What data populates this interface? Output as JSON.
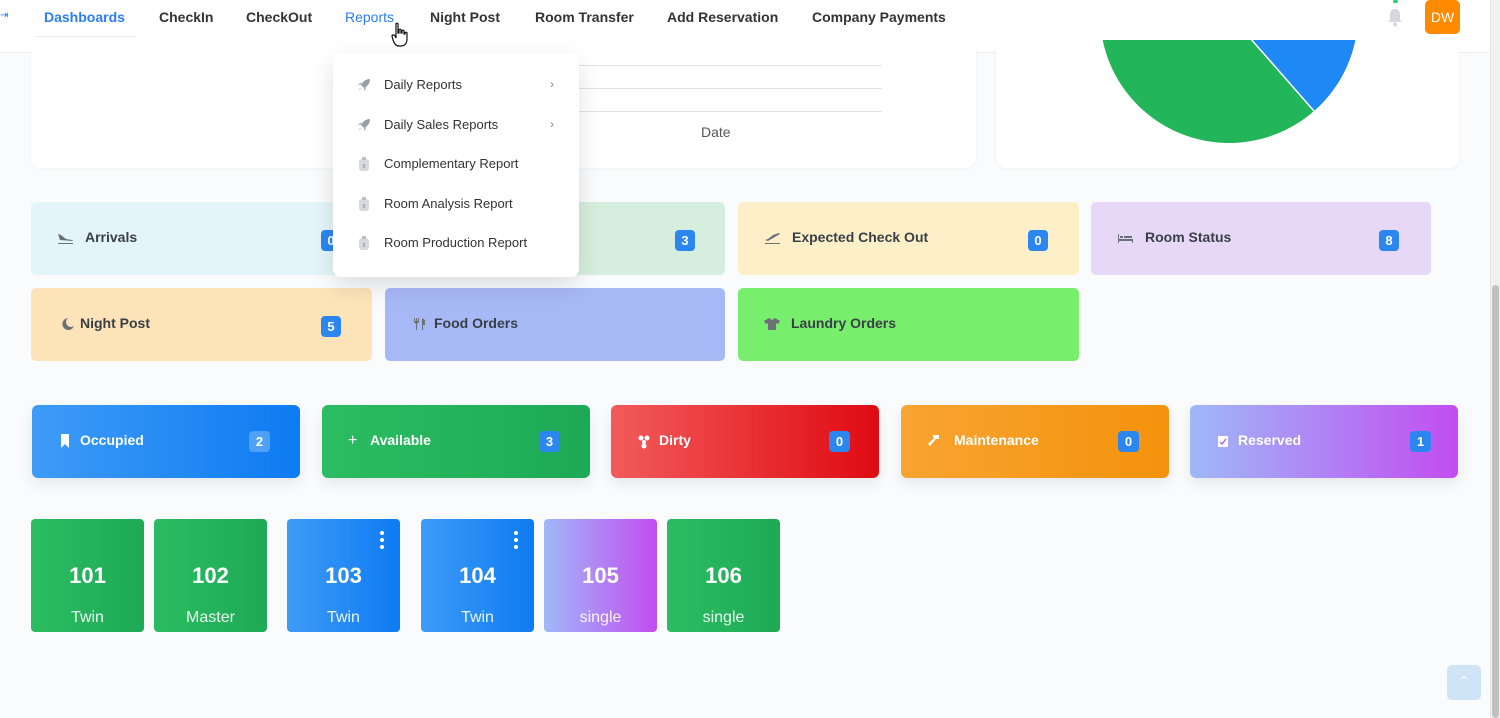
{
  "nav": {
    "items": [
      "Dashboards",
      "CheckIn",
      "CheckOut",
      "Reports",
      "Night Post",
      "Room Transfer",
      "Add Reservation",
      "Company Payments"
    ],
    "avatar_initials": "DW"
  },
  "chart": {
    "xlabel": "Date"
  },
  "reports_menu": {
    "items": [
      {
        "label": "Daily Reports",
        "icon": "rocket-icon",
        "has_submenu": true
      },
      {
        "label": "Daily Sales Reports",
        "icon": "rocket-icon",
        "has_submenu": true
      },
      {
        "label": "Complementary Report",
        "icon": "document-icon",
        "has_submenu": false
      },
      {
        "label": "Room Analysis Report",
        "icon": "document-icon",
        "has_submenu": false
      },
      {
        "label": "Room Production Report",
        "icon": "document-icon",
        "has_submenu": false
      }
    ]
  },
  "summary_tiles": [
    {
      "label": "Arrivals",
      "count": "0",
      "icon": "plane-arrival-icon",
      "bg": "#e3f5f8"
    },
    {
      "label": "",
      "count": "3",
      "icon": "",
      "bg": "#d6eedd"
    },
    {
      "label": "Expected Check Out",
      "count": "0",
      "icon": "plane-departure-icon",
      "bg": "#fdf0c9"
    },
    {
      "label": "Room Status",
      "count": "8",
      "icon": "bed-icon",
      "bg": "#e6d8f6"
    },
    {
      "label": "Night Post",
      "count": "5",
      "icon": "moon-icon",
      "bg": "#fde3b8"
    },
    {
      "label": "Food Orders",
      "count": "",
      "icon": "utensils-icon",
      "bg": "#a7b8f7"
    },
    {
      "label": "Laundry Orders",
      "count": "",
      "icon": "shirt-icon",
      "bg": "#77ee6c"
    }
  ],
  "status_tiles": [
    {
      "label": "Occupied",
      "count": "2",
      "icon": "bookmark-icon"
    },
    {
      "label": "Available",
      "count": "3",
      "icon": "plus-icon"
    },
    {
      "label": "Dirty",
      "count": "0",
      "icon": "biohazard-icon"
    },
    {
      "label": "Maintenance",
      "count": "0",
      "icon": "hammer-icon"
    },
    {
      "label": "Reserved",
      "count": "1",
      "icon": "calendar-check-icon"
    }
  ],
  "rooms": [
    {
      "number": "101",
      "type": "Twin",
      "status": "available"
    },
    {
      "number": "102",
      "type": "Master",
      "status": "available"
    },
    {
      "number": "103",
      "type": "Twin",
      "status": "occupied"
    },
    {
      "number": "104",
      "type": "Twin",
      "status": "occupied"
    },
    {
      "number": "105",
      "type": "single",
      "status": "reserved"
    },
    {
      "number": "106",
      "type": "single",
      "status": "available"
    }
  ],
  "colors": {
    "accent": "#2b7cf7",
    "available": "#22b55a",
    "occupied": "#1e88f5",
    "dirty": "#e8272b",
    "maintenance": "#f59a1a",
    "reserved": "#b070f0",
    "avatar": "#ff8a00"
  }
}
